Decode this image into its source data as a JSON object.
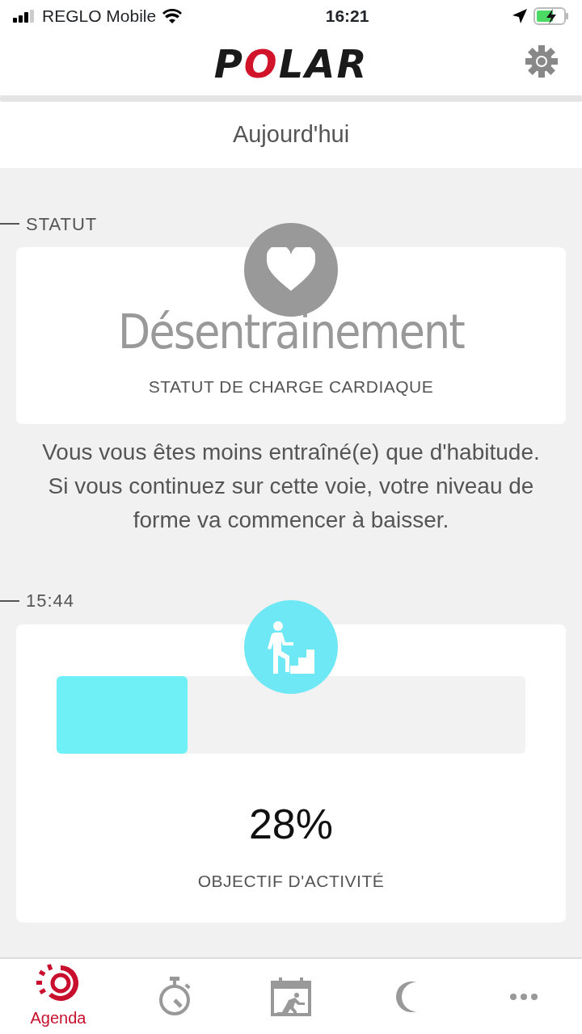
{
  "status_bar": {
    "carrier": "REGLO Mobile",
    "time": "16:21"
  },
  "header": {
    "logo": "POLAR"
  },
  "subheader": {
    "title": "Aujourd'hui"
  },
  "sections": [
    {
      "kind": "status",
      "label": "STATUT",
      "value": "Désentrainement",
      "caption": "STATUT DE CHARGE CARDIAQUE",
      "description": "Vous vous êtes moins entraîné(e) que d'habitude. Si vous continuez sur cette voie, votre niveau de forme va commencer à baisser."
    },
    {
      "kind": "activity",
      "label": "15:44",
      "level": 0.28,
      "value": "28%",
      "caption": "OBJECTIF D'ACTIVITÉ"
    }
  ],
  "tabs": [
    {
      "kind": "agenda",
      "label": "Agenda",
      "selected": true
    },
    {
      "kind": "stopwatch",
      "selected": false
    },
    {
      "kind": "calendar",
      "selected": false
    },
    {
      "kind": "moon",
      "selected": false
    },
    {
      "kind": "more",
      "selected": false
    }
  ]
}
